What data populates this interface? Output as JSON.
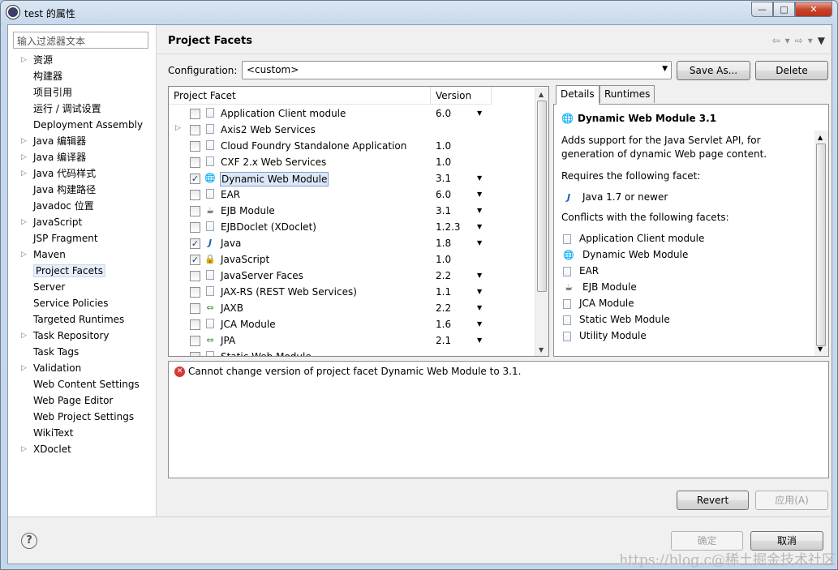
{
  "window": {
    "title": "test 的属性",
    "buttons": {
      "min": "—",
      "max": "□",
      "close": "✕"
    }
  },
  "filter_placeholder": "输入过滤器文本",
  "tree": [
    {
      "label": "资源",
      "expandable": true
    },
    {
      "label": "构建器",
      "expandable": false
    },
    {
      "label": "项目引用",
      "expandable": false
    },
    {
      "label": "运行 / 调试设置",
      "expandable": false
    },
    {
      "label": "Deployment Assembly",
      "expandable": false
    },
    {
      "label": "Java 编辑器",
      "expandable": true
    },
    {
      "label": "Java 编译器",
      "expandable": true
    },
    {
      "label": "Java 代码样式",
      "expandable": true
    },
    {
      "label": "Java 构建路径",
      "expandable": false
    },
    {
      "label": "Javadoc 位置",
      "expandable": false
    },
    {
      "label": "JavaScript",
      "expandable": true
    },
    {
      "label": "JSP Fragment",
      "expandable": false
    },
    {
      "label": "Maven",
      "expandable": true
    },
    {
      "label": "Project Facets",
      "expandable": false,
      "selected": true
    },
    {
      "label": "Server",
      "expandable": false
    },
    {
      "label": "Service Policies",
      "expandable": false
    },
    {
      "label": "Targeted Runtimes",
      "expandable": false
    },
    {
      "label": "Task Repository",
      "expandable": true
    },
    {
      "label": "Task Tags",
      "expandable": false
    },
    {
      "label": "Validation",
      "expandable": true
    },
    {
      "label": "Web Content Settings",
      "expandable": false
    },
    {
      "label": "Web Page Editor",
      "expandable": false
    },
    {
      "label": "Web Project Settings",
      "expandable": false
    },
    {
      "label": "WikiText",
      "expandable": false
    },
    {
      "label": "XDoclet",
      "expandable": true
    }
  ],
  "page": {
    "title": "Project Facets",
    "nav": {
      "back": "⇦",
      "down1": "▾",
      "fwd": "⇨",
      "down2": "▾",
      "menu": "▼"
    },
    "config_label": "Configuration:",
    "config_value": "<custom>",
    "save_as": "Save As...",
    "delete": "Delete"
  },
  "facet_table": {
    "headers": {
      "facet": "Project Facet",
      "version": "Version"
    },
    "rows": [
      {
        "name": "Application Client module",
        "version": "6.0",
        "dd": true,
        "checked": false,
        "icon": "doc-icon"
      },
      {
        "name": "Axis2 Web Services",
        "version": "",
        "dd": false,
        "checked": false,
        "icon": "doc-icon",
        "expandable": true
      },
      {
        "name": "Cloud Foundry Standalone Application",
        "version": "1.0",
        "dd": false,
        "checked": false,
        "icon": "doc-icon"
      },
      {
        "name": "CXF 2.x Web Services",
        "version": "1.0",
        "dd": false,
        "checked": false,
        "icon": "doc-icon"
      },
      {
        "name": "Dynamic Web Module",
        "version": "3.1",
        "dd": true,
        "checked": true,
        "icon": "globe-icon",
        "selected": true
      },
      {
        "name": "EAR",
        "version": "6.0",
        "dd": true,
        "checked": false,
        "icon": "doc-icon"
      },
      {
        "name": "EJB Module",
        "version": "3.1",
        "dd": true,
        "checked": false,
        "icon": "bean-icon"
      },
      {
        "name": "EJBDoclet (XDoclet)",
        "version": "1.2.3",
        "dd": true,
        "checked": false,
        "icon": "doc-icon"
      },
      {
        "name": "Java",
        "version": "1.8",
        "dd": true,
        "checked": true,
        "icon": "java-icon"
      },
      {
        "name": "JavaScript",
        "version": "1.0",
        "dd": false,
        "checked": true,
        "icon": "js-icon"
      },
      {
        "name": "JavaServer Faces",
        "version": "2.2",
        "dd": true,
        "checked": false,
        "icon": "doc-icon"
      },
      {
        "name": "JAX-RS (REST Web Services)",
        "version": "1.1",
        "dd": true,
        "checked": false,
        "icon": "doc-icon"
      },
      {
        "name": "JAXB",
        "version": "2.2",
        "dd": true,
        "checked": false,
        "icon": "jaxb-icon"
      },
      {
        "name": "JCA Module",
        "version": "1.6",
        "dd": true,
        "checked": false,
        "icon": "doc-icon"
      },
      {
        "name": "JPA",
        "version": "2.1",
        "dd": true,
        "checked": false,
        "icon": "jaxb-icon"
      },
      {
        "name": "Static Web Module",
        "version": "",
        "dd": false,
        "checked": false,
        "icon": "doc-icon"
      }
    ]
  },
  "details": {
    "tabs": [
      "Details",
      "Runtimes"
    ],
    "title": "Dynamic Web Module 3.1",
    "description": "Adds support for the Java Servlet API, for generation of dynamic Web page content.",
    "requires_label": "Requires the following facet:",
    "requires": [
      {
        "label": "Java 1.7 or newer",
        "icon": "java-icon"
      }
    ],
    "conflicts_label": "Conflicts with the following facets:",
    "conflicts": [
      {
        "label": "Application Client module",
        "icon": "doc-icon"
      },
      {
        "label": "Dynamic Web Module",
        "icon": "globe-icon"
      },
      {
        "label": "EAR",
        "icon": "doc-icon"
      },
      {
        "label": "EJB Module",
        "icon": "bean-icon"
      },
      {
        "label": "JCA Module",
        "icon": "doc-icon"
      },
      {
        "label": "Static Web Module",
        "icon": "doc-icon"
      },
      {
        "label": "Utility Module",
        "icon": "doc-icon"
      }
    ]
  },
  "message": "Cannot change version of project facet Dynamic Web Module to 3.1.",
  "buttons": {
    "revert": "Revert",
    "apply": "应用(A)",
    "ok": "确定",
    "cancel": "取消"
  },
  "watermark": "https://blog.c@稀土掘金技术社区",
  "colors": {
    "error": "#d23a3a",
    "selection": "#dce8f8",
    "window_frame": "#c4d6ea"
  }
}
